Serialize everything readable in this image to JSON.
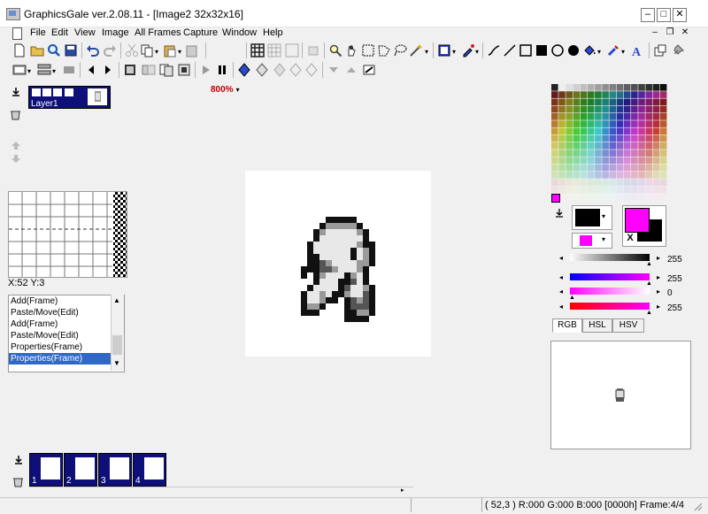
{
  "window": {
    "title": "GraphicsGale ver.2.08.11 - [Image2 32x32x16]"
  },
  "menu": {
    "items": [
      "File",
      "Edit",
      "View",
      "Image",
      "All Frames",
      "Capture",
      "Window",
      "Help"
    ]
  },
  "toolbar": {
    "zoom": "800%"
  },
  "layers": {
    "layer_name": "Layer1"
  },
  "status": {
    "coords": "X:52 Y:3",
    "text": "( 52,3 ) R:000 G:000 B:000  [0000h]  Frame:4/4"
  },
  "history": {
    "items": [
      "Add(Frame)",
      "Paste/Move(Edit)",
      "Add(Frame)",
      "Paste/Move(Edit)",
      "Properties(Frame)",
      "Properties(Frame)"
    ],
    "selected_index": 5
  },
  "colors": {
    "primary": "#000000",
    "secondary": "#ff00ff",
    "swap_label": "X",
    "brightness_value": "255",
    "r_value": "255",
    "g_value": "0",
    "b_value": "255"
  },
  "tabs": [
    "RGB",
    "HSL",
    "HSV"
  ],
  "frames": {
    "labels": [
      "1",
      "2",
      "3",
      "4"
    ]
  }
}
